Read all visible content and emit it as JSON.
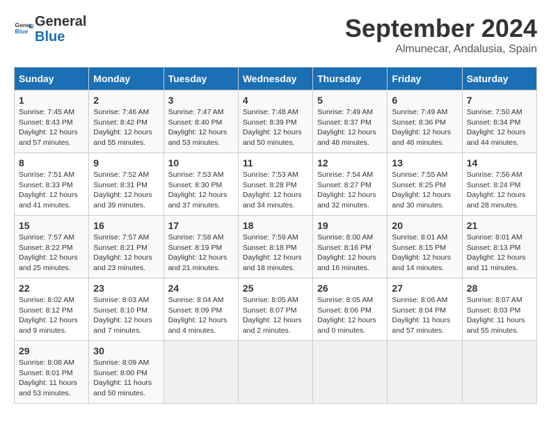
{
  "header": {
    "logo_line1": "General",
    "logo_line2": "Blue",
    "month_year": "September 2024",
    "location": "Almunecar, Andalusia, Spain"
  },
  "weekdays": [
    "Sunday",
    "Monday",
    "Tuesday",
    "Wednesday",
    "Thursday",
    "Friday",
    "Saturday"
  ],
  "weeks": [
    [
      {
        "day": "1",
        "content": "Sunrise: 7:45 AM\nSunset: 8:43 PM\nDaylight: 12 hours\nand 57 minutes."
      },
      {
        "day": "2",
        "content": "Sunrise: 7:46 AM\nSunset: 8:42 PM\nDaylight: 12 hours\nand 55 minutes."
      },
      {
        "day": "3",
        "content": "Sunrise: 7:47 AM\nSunset: 8:40 PM\nDaylight: 12 hours\nand 53 minutes."
      },
      {
        "day": "4",
        "content": "Sunrise: 7:48 AM\nSunset: 8:39 PM\nDaylight: 12 hours\nand 50 minutes."
      },
      {
        "day": "5",
        "content": "Sunrise: 7:49 AM\nSunset: 8:37 PM\nDaylight: 12 hours\nand 48 minutes."
      },
      {
        "day": "6",
        "content": "Sunrise: 7:49 AM\nSunset: 8:36 PM\nDaylight: 12 hours\nand 46 minutes."
      },
      {
        "day": "7",
        "content": "Sunrise: 7:50 AM\nSunset: 8:34 PM\nDaylight: 12 hours\nand 44 minutes."
      }
    ],
    [
      {
        "day": "8",
        "content": "Sunrise: 7:51 AM\nSunset: 8:33 PM\nDaylight: 12 hours\nand 41 minutes."
      },
      {
        "day": "9",
        "content": "Sunrise: 7:52 AM\nSunset: 8:31 PM\nDaylight: 12 hours\nand 39 minutes."
      },
      {
        "day": "10",
        "content": "Sunrise: 7:53 AM\nSunset: 8:30 PM\nDaylight: 12 hours\nand 37 minutes."
      },
      {
        "day": "11",
        "content": "Sunrise: 7:53 AM\nSunset: 8:28 PM\nDaylight: 12 hours\nand 34 minutes."
      },
      {
        "day": "12",
        "content": "Sunrise: 7:54 AM\nSunset: 8:27 PM\nDaylight: 12 hours\nand 32 minutes."
      },
      {
        "day": "13",
        "content": "Sunrise: 7:55 AM\nSunset: 8:25 PM\nDaylight: 12 hours\nand 30 minutes."
      },
      {
        "day": "14",
        "content": "Sunrise: 7:56 AM\nSunset: 8:24 PM\nDaylight: 12 hours\nand 28 minutes."
      }
    ],
    [
      {
        "day": "15",
        "content": "Sunrise: 7:57 AM\nSunset: 8:22 PM\nDaylight: 12 hours\nand 25 minutes."
      },
      {
        "day": "16",
        "content": "Sunrise: 7:57 AM\nSunset: 8:21 PM\nDaylight: 12 hours\nand 23 minutes."
      },
      {
        "day": "17",
        "content": "Sunrise: 7:58 AM\nSunset: 8:19 PM\nDaylight: 12 hours\nand 21 minutes."
      },
      {
        "day": "18",
        "content": "Sunrise: 7:59 AM\nSunset: 8:18 PM\nDaylight: 12 hours\nand 18 minutes."
      },
      {
        "day": "19",
        "content": "Sunrise: 8:00 AM\nSunset: 8:16 PM\nDaylight: 12 hours\nand 16 minutes."
      },
      {
        "day": "20",
        "content": "Sunrise: 8:01 AM\nSunset: 8:15 PM\nDaylight: 12 hours\nand 14 minutes."
      },
      {
        "day": "21",
        "content": "Sunrise: 8:01 AM\nSunset: 8:13 PM\nDaylight: 12 hours\nand 11 minutes."
      }
    ],
    [
      {
        "day": "22",
        "content": "Sunrise: 8:02 AM\nSunset: 8:12 PM\nDaylight: 12 hours\nand 9 minutes."
      },
      {
        "day": "23",
        "content": "Sunrise: 8:03 AM\nSunset: 8:10 PM\nDaylight: 12 hours\nand 7 minutes."
      },
      {
        "day": "24",
        "content": "Sunrise: 8:04 AM\nSunset: 8:09 PM\nDaylight: 12 hours\nand 4 minutes."
      },
      {
        "day": "25",
        "content": "Sunrise: 8:05 AM\nSunset: 8:07 PM\nDaylight: 12 hours\nand 2 minutes."
      },
      {
        "day": "26",
        "content": "Sunrise: 8:05 AM\nSunset: 8:06 PM\nDaylight: 12 hours\nand 0 minutes."
      },
      {
        "day": "27",
        "content": "Sunrise: 8:06 AM\nSunset: 8:04 PM\nDaylight: 11 hours\nand 57 minutes."
      },
      {
        "day": "28",
        "content": "Sunrise: 8:07 AM\nSunset: 8:03 PM\nDaylight: 11 hours\nand 55 minutes."
      }
    ],
    [
      {
        "day": "29",
        "content": "Sunrise: 8:08 AM\nSunset: 8:01 PM\nDaylight: 11 hours\nand 53 minutes."
      },
      {
        "day": "30",
        "content": "Sunrise: 8:09 AM\nSunset: 8:00 PM\nDaylight: 11 hours\nand 50 minutes."
      },
      {
        "day": "",
        "content": ""
      },
      {
        "day": "",
        "content": ""
      },
      {
        "day": "",
        "content": ""
      },
      {
        "day": "",
        "content": ""
      },
      {
        "day": "",
        "content": ""
      }
    ]
  ]
}
